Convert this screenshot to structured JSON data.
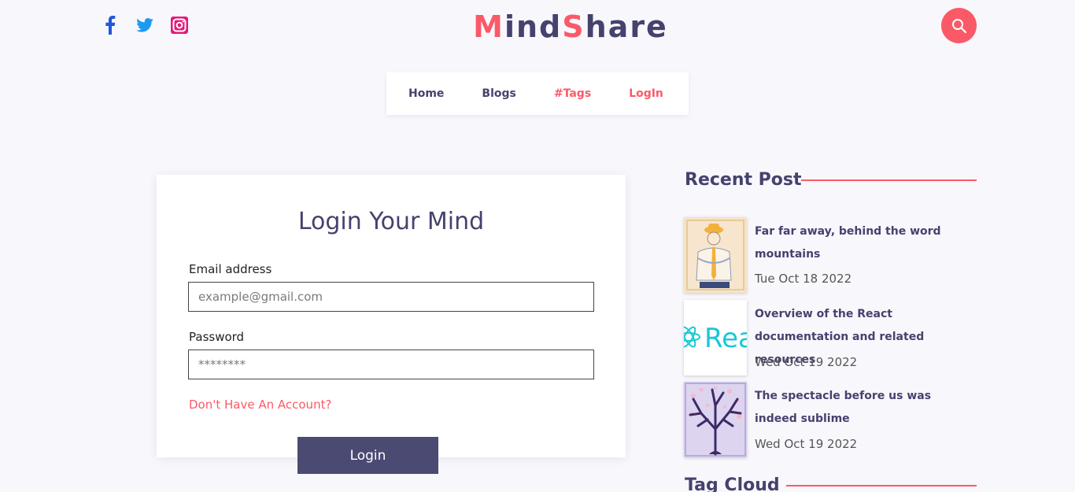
{
  "header": {
    "logo_part1": "M",
    "logo_part2": "ind",
    "logo_part3": "S",
    "logo_part4": "hare",
    "social_icons": [
      "facebook-icon",
      "twitter-icon",
      "instagram-icon"
    ],
    "search_icon": "search-icon"
  },
  "nav": {
    "items": [
      {
        "label": "Home"
      },
      {
        "label": "Blogs"
      },
      {
        "label": "#Tags"
      },
      {
        "label": "LogIn"
      }
    ]
  },
  "login": {
    "title": "Login Your Mind",
    "email_label": "Email address",
    "email_placeholder": "example@gmail.com",
    "email_value": "",
    "password_label": "Password",
    "password_placeholder": "********",
    "password_value": "",
    "signup_link": "Don't Have An Account?",
    "submit_label": "Login"
  },
  "sidebar": {
    "recent_heading": "Recent Post",
    "posts": [
      {
        "title": "Far far away, behind the word mountains",
        "date": "Tue Oct 18 2022"
      },
      {
        "title": "Overview of the React documentation and related resources",
        "date": "Wed Oct 19 2022"
      },
      {
        "title": "The spectacle before us was indeed sublime",
        "date": "Wed Oct 19 2022"
      }
    ],
    "tag_heading": "Tag Cloud",
    "react_thumb_text": "Rea"
  },
  "colors": {
    "accent": "#fa5a68",
    "primary": "#45426e",
    "button": "#4b4a72",
    "background": "#f8f7fc"
  }
}
